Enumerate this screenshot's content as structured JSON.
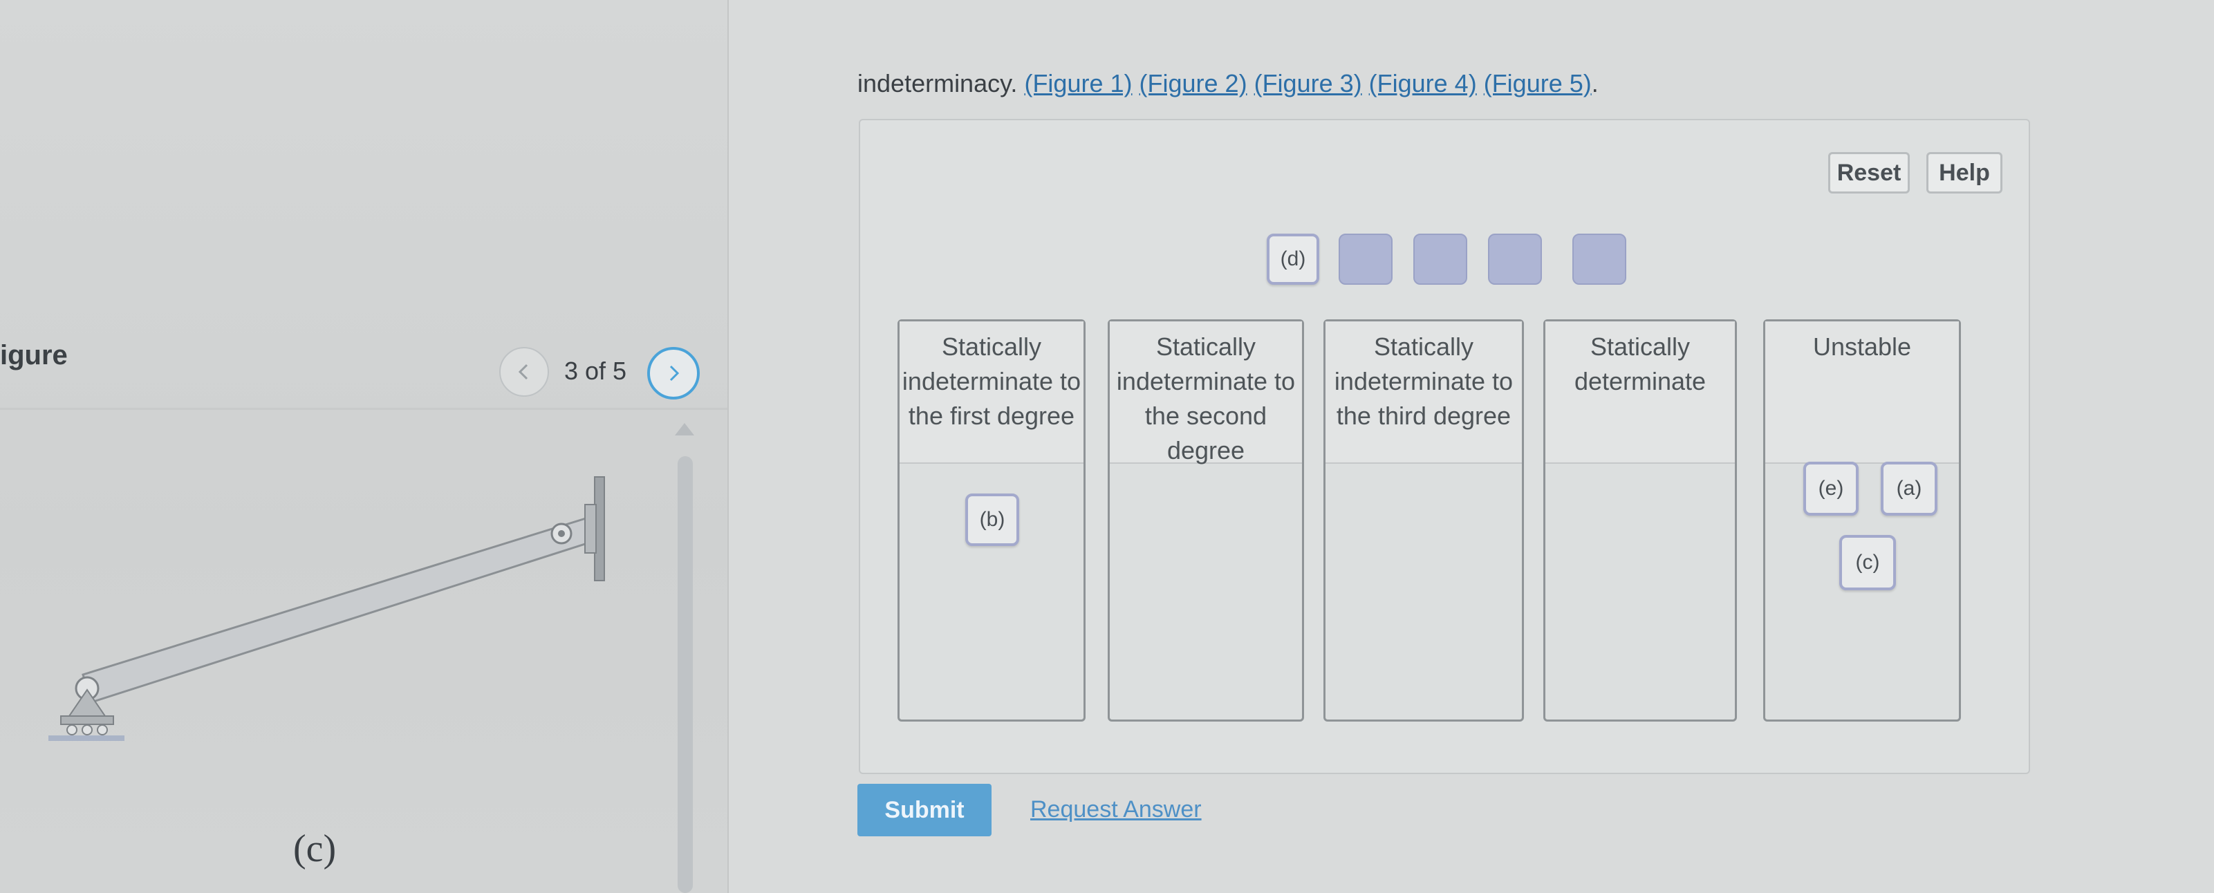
{
  "figure_panel": {
    "title": "igure",
    "pager": "3 of 5",
    "figure_caption": "(c)"
  },
  "question": {
    "text": "indeterminacy.",
    "links": [
      "(Figure 1)",
      "(Figure 2)",
      "(Figure 3)",
      "(Figure 4)",
      "(Figure 5)"
    ],
    "end": "."
  },
  "toolbar": {
    "reset_label": "Reset",
    "help_label": "Help"
  },
  "pool": {
    "chips": [
      "(d)"
    ],
    "empty_slots": 4
  },
  "buckets": [
    {
      "title": "Statically indeterminate to the first degree",
      "items": [
        "(b)"
      ]
    },
    {
      "title": "Statically indeterminate to the second degree",
      "items": []
    },
    {
      "title": "Statically indeterminate to the third degree",
      "items": []
    },
    {
      "title": "Statically determinate",
      "items": []
    },
    {
      "title": "Unstable",
      "items": [
        "(e)",
        "(a)",
        "(c)"
      ]
    }
  ],
  "actions": {
    "submit_label": "Submit",
    "request_label": "Request Answer"
  },
  "colors": {
    "accent": "#5ba3d3",
    "link": "#2d6fa8",
    "chip_border": "#a3a9cc",
    "empty_slot": "#aeb5d4",
    "nav_active": "#4aa3d9"
  },
  "icons": [
    "chevron-left-icon",
    "chevron-right-icon",
    "scroll-up-icon"
  ]
}
